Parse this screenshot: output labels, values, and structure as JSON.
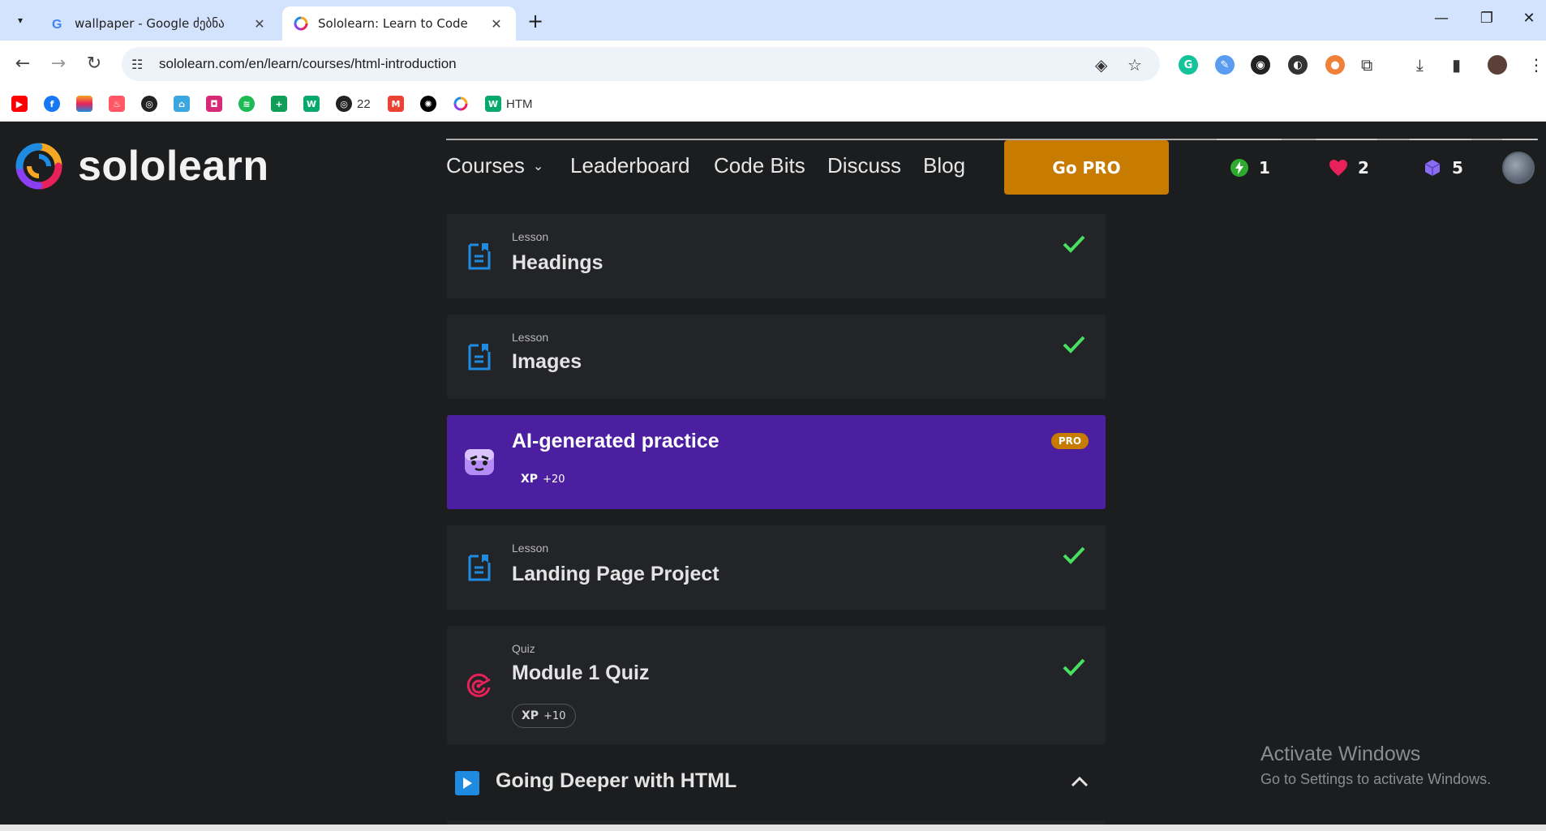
{
  "browser": {
    "tabs": [
      {
        "title": "wallpaper - Google ძებნა",
        "active": false
      },
      {
        "title": "Sololearn: Learn to Code",
        "active": true
      }
    ],
    "address": "sololearn.com/en/learn/courses/html-introduction",
    "bookmarks": [
      {
        "icon": "youtube-icon",
        "label": ""
      },
      {
        "icon": "facebook-icon",
        "label": ""
      },
      {
        "icon": "rainbow-icon",
        "label": ""
      },
      {
        "icon": "tinder-icon",
        "label": ""
      },
      {
        "icon": "github-icon",
        "label": ""
      },
      {
        "icon": "house-icon",
        "label": ""
      },
      {
        "icon": "instagram-icon",
        "label": ""
      },
      {
        "icon": "spotify-icon",
        "label": ""
      },
      {
        "icon": "sheets-icon",
        "label": ""
      },
      {
        "icon": "w3schools-icon",
        "label": ""
      },
      {
        "icon": "github-icon",
        "label": "22"
      },
      {
        "icon": "gmail-icon",
        "label": ""
      },
      {
        "icon": "openai-icon",
        "label": ""
      },
      {
        "icon": "sololearn-icon",
        "label": ""
      },
      {
        "icon": "w3schools-icon",
        "label": "HTM"
      }
    ]
  },
  "header": {
    "logo_text": "sololearn",
    "nav": [
      "Courses",
      "Leaderboard",
      "Code Bits",
      "Discuss",
      "Blog"
    ],
    "gopro_label": "Go PRO",
    "streak": "1",
    "hearts": "2",
    "gems": "5",
    "colors": {
      "gopro": "#c77b00",
      "bolt": "#2eaa2e",
      "heart": "#e8215b",
      "gem": "#8a6cf0"
    }
  },
  "lessons": [
    {
      "type": "Lesson",
      "name": "Headings",
      "completed": true
    },
    {
      "type": "Lesson",
      "name": "Images",
      "completed": true
    },
    {
      "type": "",
      "name": "AI-generated practice",
      "badge": "PRO",
      "xp_label": "XP",
      "xp_value": "+20"
    },
    {
      "type": "Lesson",
      "name": "Landing Page Project",
      "completed": true
    },
    {
      "type": "Quiz",
      "name": "Module 1 Quiz",
      "completed": true,
      "xp_label": "XP",
      "xp_value": "+10"
    }
  ],
  "section": {
    "title": "Going Deeper with HTML"
  },
  "watermark": {
    "line1": "Activate Windows",
    "line2": "Go to Settings to activate Windows."
  },
  "colors": {
    "page_bg": "#1c1d1f",
    "card_bg": "#232427",
    "ai_card": "#4b1fa0",
    "check": "#48e060",
    "lesson_icon": "#1f8be0",
    "quiz_icon": "#e8215b"
  }
}
